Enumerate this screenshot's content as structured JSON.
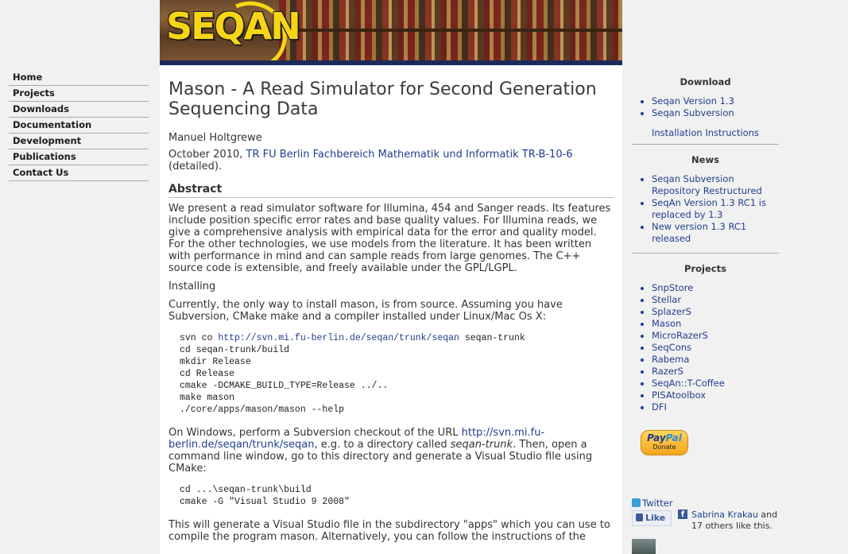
{
  "logo": {
    "text": "SEQAN"
  },
  "nav": [
    {
      "label": "Home"
    },
    {
      "label": "Projects"
    },
    {
      "label": "Downloads"
    },
    {
      "label": "Documentation"
    },
    {
      "label": "Development"
    },
    {
      "label": "Publications"
    },
    {
      "label": "Contact Us"
    }
  ],
  "main": {
    "title": "Mason - A Read Simulator for Second Generation Sequencing Data",
    "author": "Manuel Holtgrewe",
    "date_prefix": "October 2010, ",
    "report_link": "TR FU Berlin Fachbereich Mathematik und Informatik TR-B-10-6",
    "date_suffix": " (detailed).",
    "abstract_heading": "Abstract",
    "abstract_text": "We present a read simulator software for Illumina, 454 and Sanger reads. Its features include position specific error rates and base quality values. For Illumina reads, we give a comprehensive analysis with empirical data for the error and quality model. For the other technologies, we use models from the literature. It has been written with performance in mind and can sample reads from large genomes. The C++ source code is extensible, and freely available under the GPL/LGPL.",
    "installing_heading": "Installing",
    "installing_text": "Currently, the only way to install mason, is from source. Assuming you have Subversion, CMake make and a compiler installed under Linux/Mac Os X:",
    "code1": {
      "line1_prefix": "svn co ",
      "line1_link": "http://svn.mi.fu-berlin.de/seqan/trunk/seqan",
      "line1_suffix": " seqan-trunk",
      "rest": "cd seqan-trunk/build\nmkdir Release\ncd Release\ncmake -DCMAKE_BUILD_TYPE=Release ../..\nmake mason\n./core/apps/mason/mason --help"
    },
    "windows_prefix": "On Windows, perform a Subversion checkout of the URL ",
    "windows_link": "http://svn.mi.fu-berlin.de/seqan/trunk/seqan",
    "windows_mid": ", e.g. to a directory called ",
    "windows_em": "seqan-trunk",
    "windows_suffix": ". Then, open a command line window, go to this directory and generate a Visual Studio file using CMake:",
    "code2": "cd ...\\seqan-trunk\\build\ncmake -G \"Visual Studio 9 2008\"",
    "closing_text": "This will generate a Visual Studio file in the subdirectory \"apps\" which you can use to compile the program mason. Alternatively, you can follow the instructions of the"
  },
  "sidebar": {
    "download_heading": "Download",
    "download_links": [
      "Seqan Version 1.3",
      "Seqan Subversion"
    ],
    "install_link": "Installation Instructions",
    "news_heading": "News",
    "news_links": [
      "Seqan Subversion Repository Restructured",
      "SeqAn Version 1.3 RC1 is replaced by 1.3",
      "New version 1.3 RC1 released"
    ],
    "projects_heading": "Projects",
    "project_links": [
      "SnpStore",
      "Stellar",
      "SplazerS",
      "Mason",
      "MicroRazerS",
      "SeqCons",
      "Rabema",
      "RazerS",
      "SeqAn::T-Coffee",
      "PISAtoolbox",
      "DFI"
    ]
  },
  "paypal": {
    "brand_a": "Pay",
    "brand_b": "Pal",
    "label": "Donate"
  },
  "social": {
    "twitter": "Twitter",
    "like_label": "Like",
    "fb_icon": "f",
    "fb_name": "Sabrina Krakau",
    "fb_suffix": " and 17 others like this."
  },
  "icons": {
    "twitter": "twitter-bird-icon",
    "facebook": "facebook-icon",
    "like": "thumbs-up-icon"
  }
}
